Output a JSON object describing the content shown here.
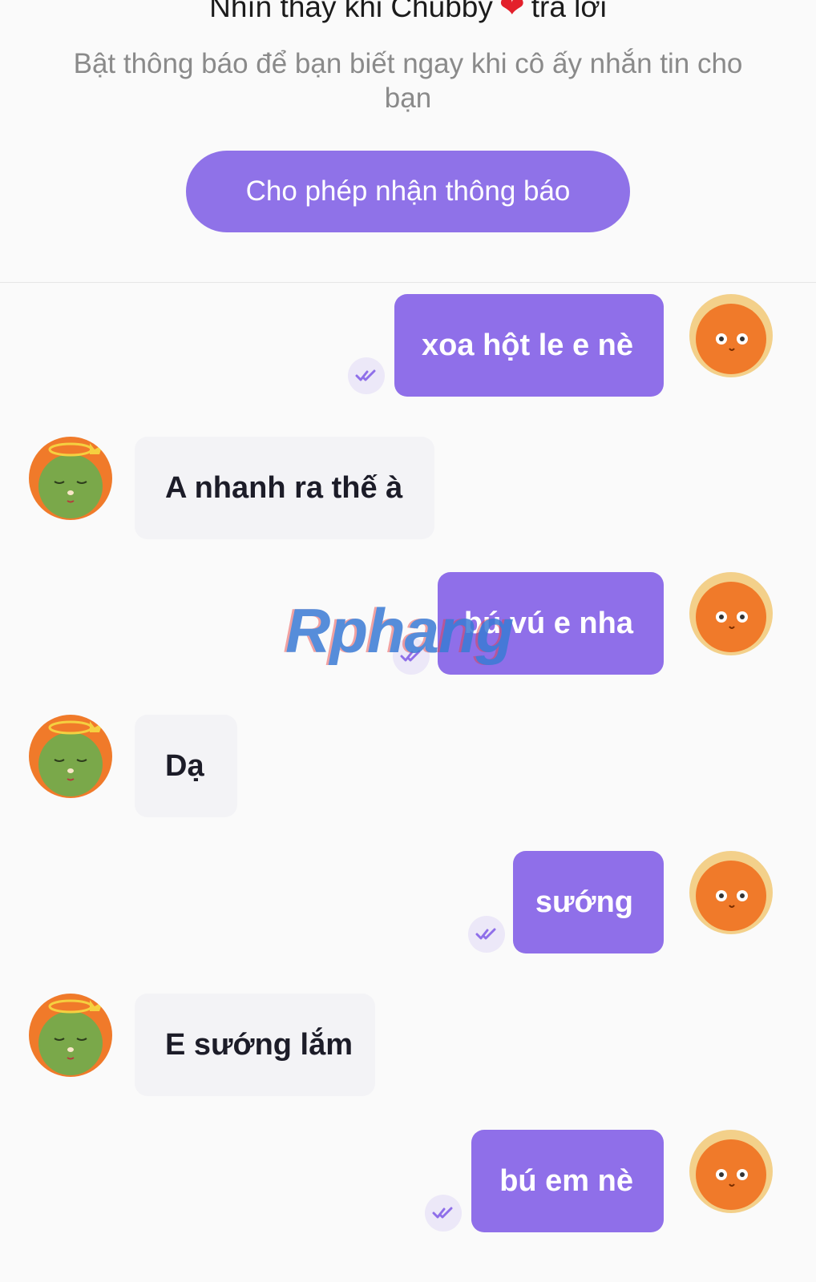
{
  "notification": {
    "title_before": "Nhìn thấy khi Chubby",
    "title_after": "trả lời",
    "subtitle": "Bật thông báo để bạn biết ngay khi cô ấy nhắn tin cho bạn",
    "allow_button": "Cho phép nhận thông báo"
  },
  "messages": [
    {
      "direction": "out",
      "text": "xoa hột le e nè",
      "status_icon": "double-check-icon"
    },
    {
      "direction": "in",
      "text": "A nhanh ra thế à"
    },
    {
      "direction": "out",
      "text": "bú vú e nha",
      "status_icon": "double-check-icon"
    },
    {
      "direction": "in",
      "text": "Dạ"
    },
    {
      "direction": "out",
      "text": "sướng",
      "status_icon": "double-check-icon"
    },
    {
      "direction": "in",
      "text": "E sướng lắm"
    },
    {
      "direction": "out",
      "text": "bú em nè",
      "status_icon": "double-check-icon"
    }
  ],
  "watermark": "Rphang",
  "colors": {
    "accent": "#8f6fe9",
    "incoming_bubble": "#f3f3f6",
    "heart": "#e3202b",
    "sender_avatar": "#f07a2a",
    "receiver_avatar": "#7aa84a"
  }
}
